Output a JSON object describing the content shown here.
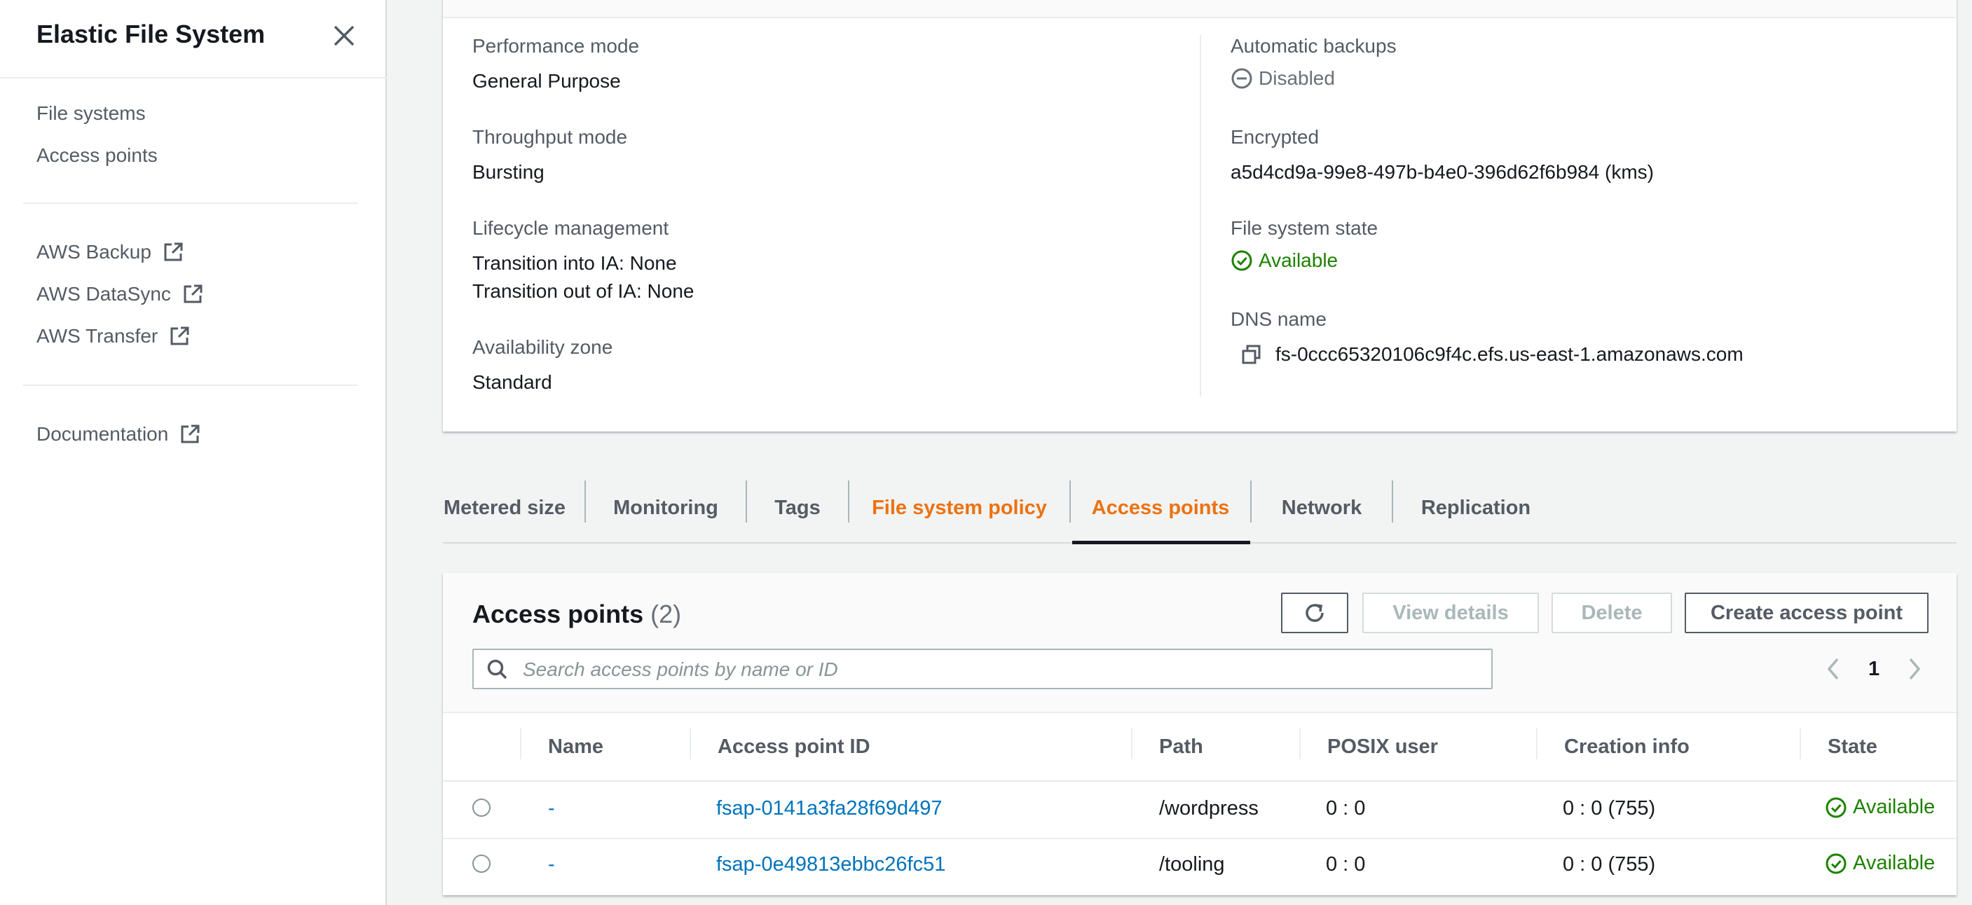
{
  "sidebar": {
    "title": "Elastic File System",
    "nav": [
      {
        "label": "File systems"
      },
      {
        "label": "Access points"
      }
    ],
    "services": [
      {
        "label": "AWS Backup",
        "icon": "external-link-icon"
      },
      {
        "label": "AWS DataSync",
        "icon": "external-link-icon"
      },
      {
        "label": "AWS Transfer",
        "icon": "external-link-icon"
      }
    ],
    "docs": {
      "label": "Documentation",
      "icon": "external-link-icon"
    }
  },
  "details": {
    "performance_mode": {
      "label": "Performance mode",
      "value": "General Purpose"
    },
    "throughput_mode": {
      "label": "Throughput mode",
      "value": "Bursting"
    },
    "lifecycle": {
      "label": "Lifecycle management",
      "value_1": "Transition into IA: None",
      "value_2": "Transition out of IA: None"
    },
    "availability_zone": {
      "label": "Availability zone",
      "value": "Standard"
    },
    "automatic_backups": {
      "label": "Automatic backups",
      "value": "Disabled",
      "icon": "minus-circle-icon"
    },
    "encrypted": {
      "label": "Encrypted",
      "value": "a5d4cd9a-99e8-497b-b4e0-396d62f6b984 (kms)"
    },
    "state": {
      "label": "File system state",
      "value": "Available",
      "icon": "check-circle-icon"
    },
    "dns": {
      "label": "DNS name",
      "value": "fs-0ccc65320106c9f4c.efs.us-east-1.amazonaws.com",
      "icon": "copy-icon"
    }
  },
  "tabs": [
    {
      "label": "Metered size"
    },
    {
      "label": "Monitoring"
    },
    {
      "label": "Tags"
    },
    {
      "label": "File system policy"
    },
    {
      "label": "Access points",
      "active": true
    },
    {
      "label": "Network"
    },
    {
      "label": "Replication"
    }
  ],
  "access_points": {
    "title": "Access points",
    "count": "(2)",
    "buttons": {
      "refresh_icon": "refresh-icon",
      "view_details": "View details",
      "delete": "Delete",
      "create": "Create access point"
    },
    "search_placeholder": "Search access points by name or ID",
    "page": "1",
    "columns": [
      "Name",
      "Access point ID",
      "Path",
      "POSIX user",
      "Creation info",
      "State"
    ],
    "rows": [
      {
        "name": "-",
        "id": "fsap-0141a3fa28f69d497",
        "path": "/wordpress",
        "posix": "0 : 0",
        "creation": "0 : 0 (755)",
        "state": "Available"
      },
      {
        "name": "-",
        "id": "fsap-0e49813ebbc26fc51",
        "path": "/tooling",
        "posix": "0 : 0",
        "creation": "0 : 0 (755)",
        "state": "Available"
      }
    ]
  },
  "colors": {
    "accent_orange": "#ec7211",
    "link_blue": "#0073bb",
    "success_green": "#1d8102"
  }
}
